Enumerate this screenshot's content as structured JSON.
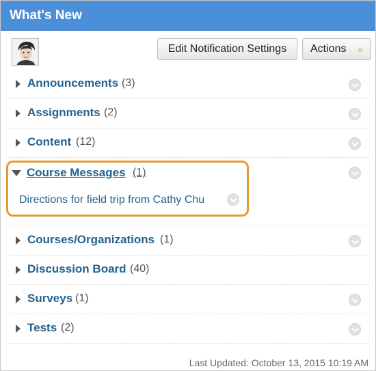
{
  "header": {
    "title": "What's New"
  },
  "toolbar": {
    "notify_label": "Edit Notification Settings",
    "actions_label": "Actions",
    "actions_chevron": "»"
  },
  "sections": [
    {
      "label": "Announcements",
      "count": "(3)"
    },
    {
      "label": "Assignments",
      "count": "(2)"
    },
    {
      "label": "Content",
      "count": "(12)"
    },
    {
      "label": "Course Messages",
      "count": "(1)",
      "expanded": true,
      "items": [
        "Directions for field trip from Cathy Chu"
      ]
    },
    {
      "label": "Courses/Organizations",
      "count": "(1)"
    },
    {
      "label": "Discussion Board",
      "count": "(40)"
    },
    {
      "label": "Surveys",
      "count": "(1)"
    },
    {
      "label": "Tests",
      "count": "(2)"
    }
  ],
  "footer": {
    "last_updated": "Last Updated: October 13, 2015 10:19 AM"
  },
  "colors": {
    "header_bg": "#4a8fd8",
    "link": "#24628f",
    "highlight": "#e8992b"
  }
}
